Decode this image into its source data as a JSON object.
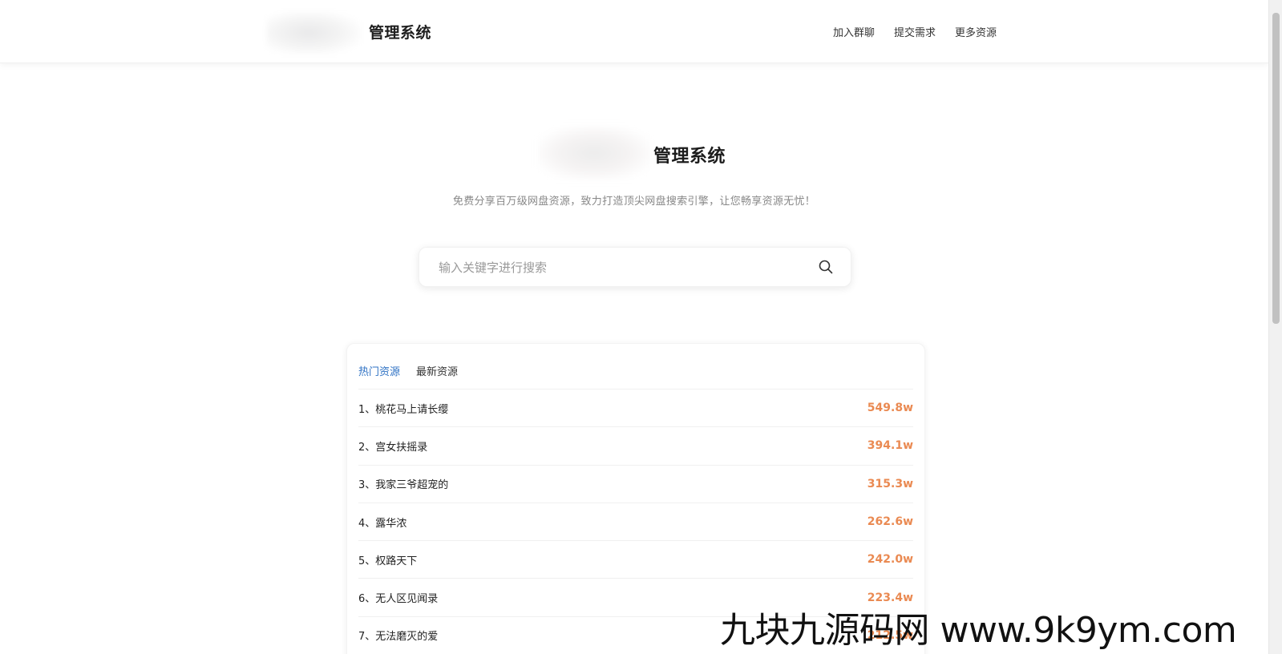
{
  "header": {
    "title": "管理系统",
    "nav": [
      "加入群聊",
      "提交需求",
      "更多资源"
    ]
  },
  "hero": {
    "title": "管理系统",
    "slogan": "免费分享百万级网盘资源，致力打造顶尖网盘搜索引擎，让您畅享资源无忧！"
  },
  "search": {
    "placeholder": "输入关键字进行搜索",
    "value": ""
  },
  "tabs": [
    {
      "label": "热门资源",
      "active": true
    },
    {
      "label": "最新资源",
      "active": false
    }
  ],
  "list": [
    {
      "name": "1、桃花马上请长缨",
      "count": "549.8w"
    },
    {
      "name": "2、宫女扶摇录",
      "count": "394.1w"
    },
    {
      "name": "3、我家三爷超宠的",
      "count": "315.3w"
    },
    {
      "name": "4、露华浓",
      "count": "262.6w"
    },
    {
      "name": "5、权路天下",
      "count": "242.0w"
    },
    {
      "name": "6、无人区见闻录",
      "count": "223.4w"
    },
    {
      "name": "7、无法磨灭的爱",
      "count": "212.5w"
    }
  ],
  "watermark": "九块九源码网 www.9k9ym.com",
  "colors": {
    "active_tab": "#2f72c4",
    "count": "#ea8a52"
  }
}
